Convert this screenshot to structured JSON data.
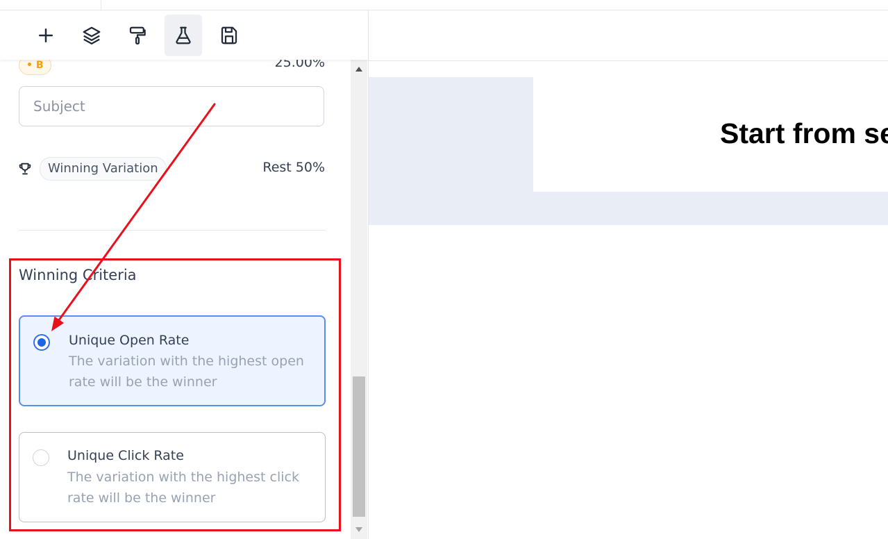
{
  "toolbar": {
    "tools": [
      {
        "icon": "plus-icon",
        "active": false
      },
      {
        "icon": "layers-icon",
        "active": false
      },
      {
        "icon": "paint-roller-icon",
        "active": false
      },
      {
        "icon": "flask-icon",
        "active": true
      },
      {
        "icon": "save-icon",
        "active": false
      }
    ]
  },
  "variation_b": {
    "label": "• B",
    "percentage": "25.00%"
  },
  "subject": {
    "placeholder": "Subject",
    "value": ""
  },
  "winning_variation": {
    "label": "Winning Variation",
    "share": "Rest 50%"
  },
  "winning_criteria": {
    "title": "Winning Criteria",
    "options": [
      {
        "title": "Unique Open Rate",
        "description": "The variation with the highest open rate will be the winner",
        "selected": true
      },
      {
        "title": "Unique Click Rate",
        "description": "The variation with the highest click rate will be the winner",
        "selected": false
      }
    ]
  },
  "canvas": {
    "heading": "Start from se"
  },
  "colors": {
    "accent": "#1f63e6",
    "annotation": "#e8101a",
    "badge": "#f59e0b"
  }
}
